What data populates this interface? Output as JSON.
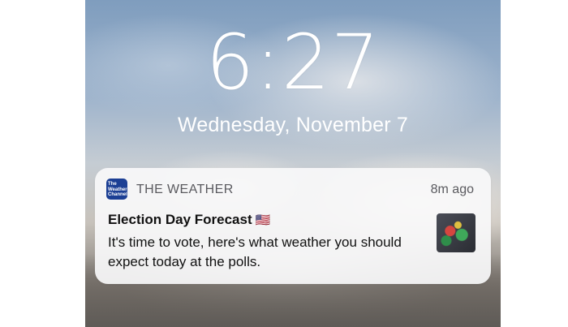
{
  "lock_screen": {
    "time": "6:27",
    "date": "Wednesday, November 7"
  },
  "notification": {
    "app_icon_text": [
      "The",
      "Weather",
      "Channel"
    ],
    "app_name": "THE WEATHER",
    "timestamp": "8m ago",
    "title": "Election Day Forecast",
    "title_emoji": "🇺🇸",
    "body": "It's time to vote, here's what weather you should expect today at the polls.",
    "thumbnail": "weather-map-thumbnail"
  },
  "colors": {
    "app_icon_bg": "#1c3f94",
    "card_bg": "#f8f8fa"
  }
}
